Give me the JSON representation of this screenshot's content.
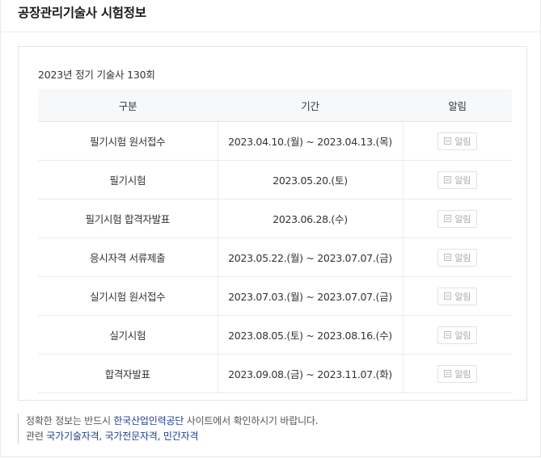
{
  "panel": {
    "title": "공장관리기술사 시험정보"
  },
  "exam": {
    "title": "2023년 정기 기술사 130회",
    "columns": [
      "구분",
      "기간",
      "알림"
    ],
    "rows": [
      {
        "name": "필기시험 원서접수",
        "period": "2023.04.10.(월) ~ 2023.04.13.(목)",
        "alarm": "알림"
      },
      {
        "name": "필기시험",
        "period": "2023.05.20.(토)",
        "alarm": "알림"
      },
      {
        "name": "필기시험 합격자발표",
        "period": "2023.06.28.(수)",
        "alarm": "알림"
      },
      {
        "name": "응시자격 서류제출",
        "period": "2023.05.22.(월) ~ 2023.07.07.(금)",
        "alarm": "알림"
      },
      {
        "name": "실기시험 원서접수",
        "period": "2023.07.03.(월) ~ 2023.07.07.(금)",
        "alarm": "알림"
      },
      {
        "name": "실기시험",
        "period": "2023.08.05.(토) ~ 2023.08.16.(수)",
        "alarm": "알림"
      },
      {
        "name": "합격자발표",
        "period": "2023.09.08.(금) ~ 2023.11.07.(화)",
        "alarm": "알림"
      }
    ]
  },
  "notice": {
    "line1_prefix": "정확한 정보는 반드시 ",
    "line1_link": "한국산업인력공단",
    "line1_suffix": " 사이트에서 확인하시기 바랍니다.",
    "line2_prefix": "관련 ",
    "line2_links": [
      "국가기술자격",
      "국가전문자격",
      "민간자격"
    ],
    "line2_separator": ", "
  },
  "colors": {
    "link": "#1f3f8f",
    "header_bg": "#f7f8fa",
    "border": "#e4e4e4"
  },
  "icons": {
    "alarm": "calendar-icon"
  }
}
